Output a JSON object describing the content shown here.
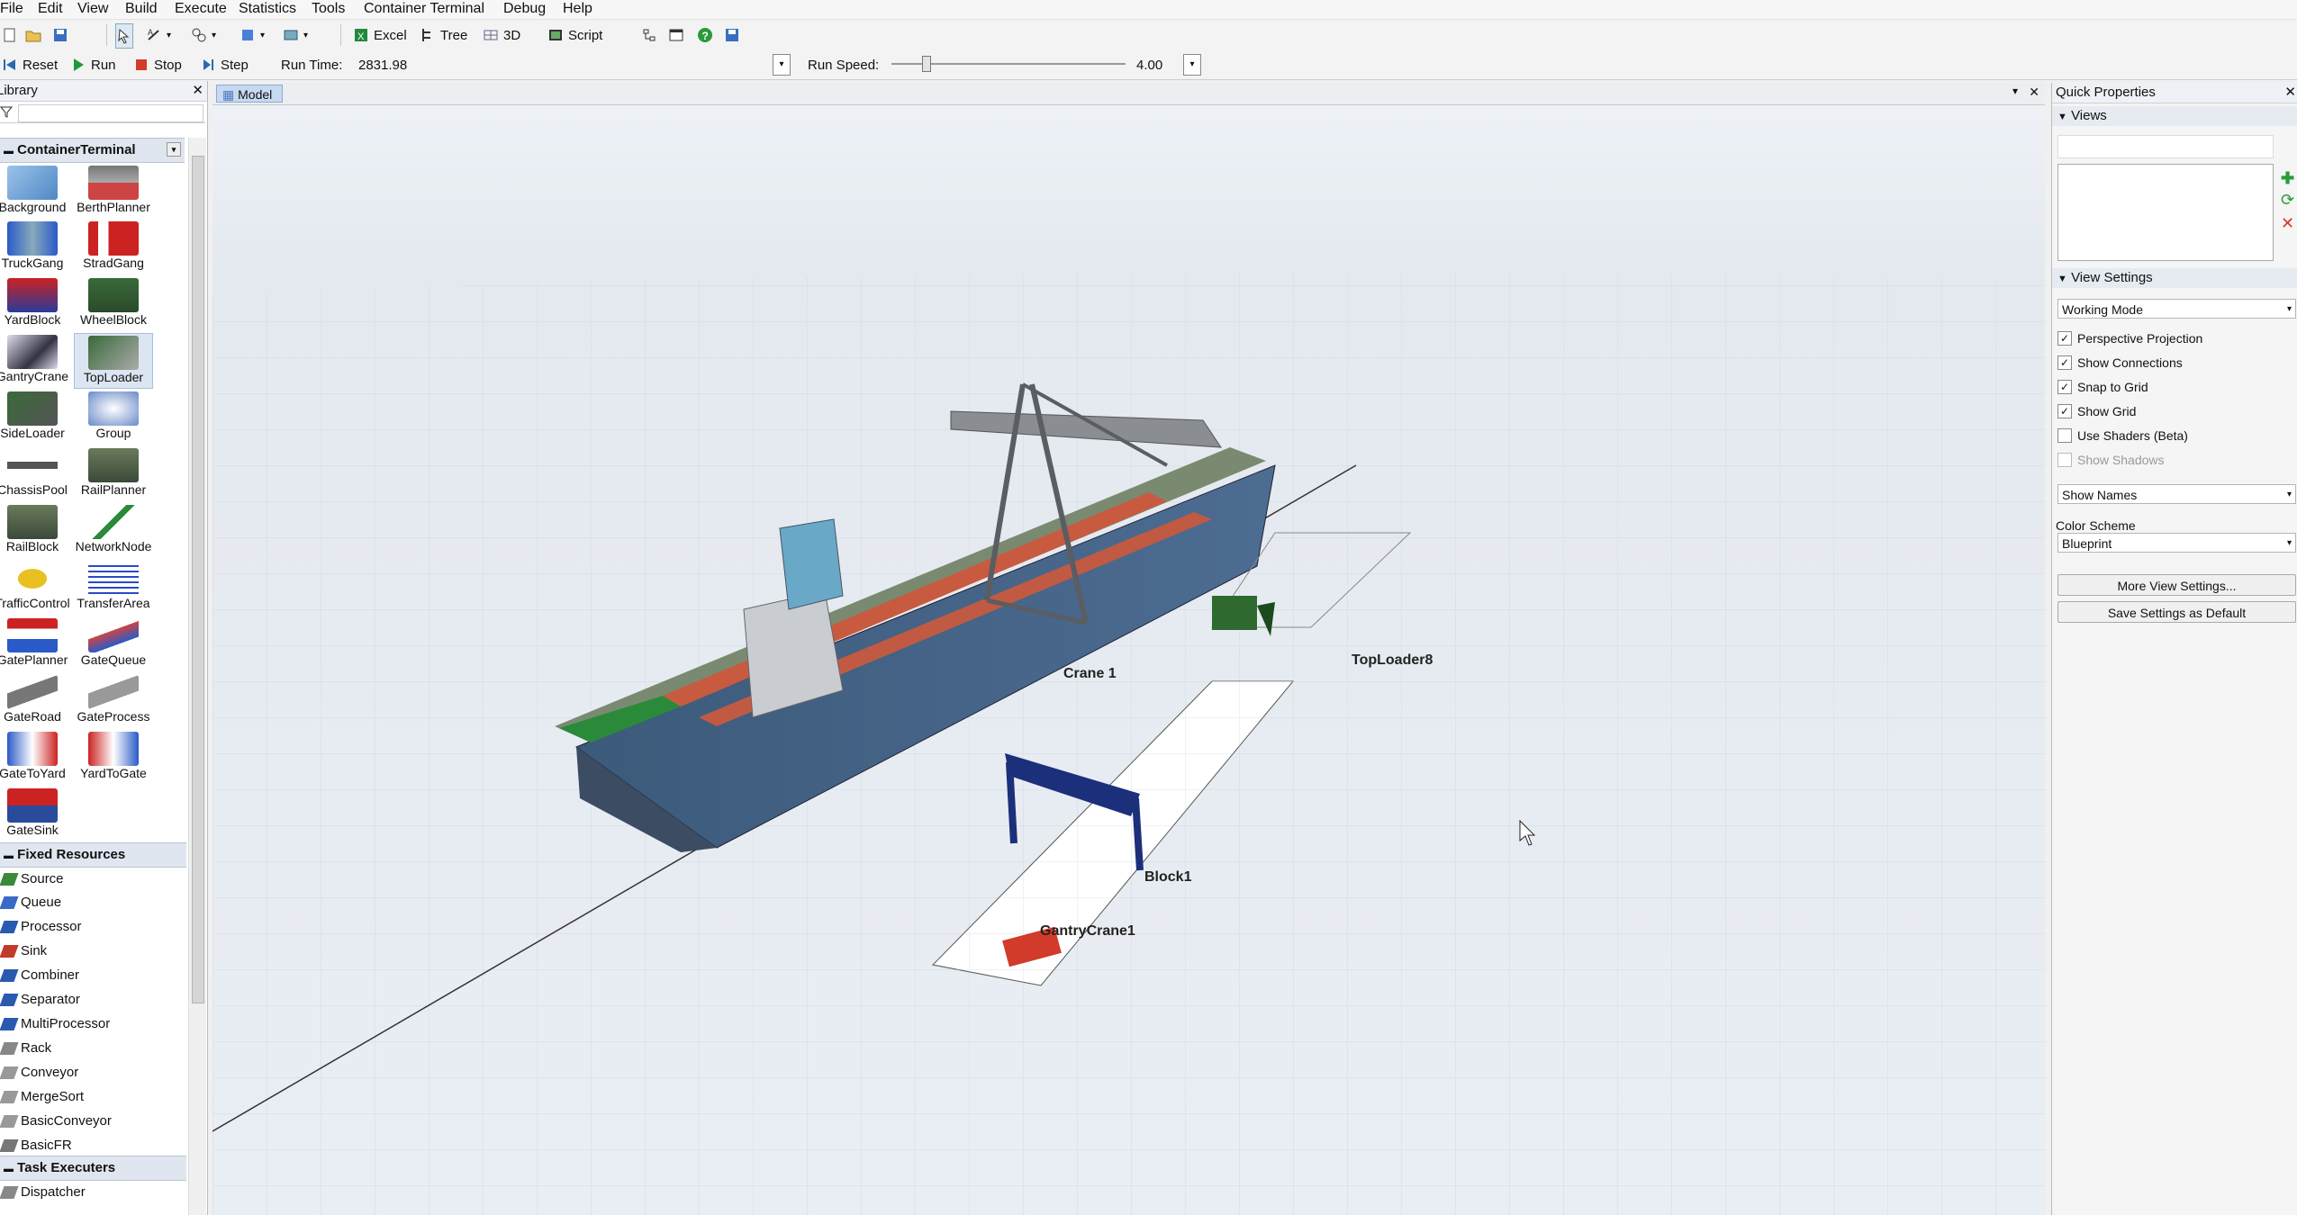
{
  "menu": [
    "File",
    "Edit",
    "View",
    "Build",
    "Execute",
    "Statistics",
    "Tools",
    "Container Terminal",
    "Debug",
    "Help"
  ],
  "toolbar1": {
    "excel": "Excel",
    "tree": "Tree",
    "three_d": "3D",
    "script": "Script"
  },
  "run": {
    "reset": "Reset",
    "run": "Run",
    "stop": "Stop",
    "step": "Step",
    "run_time_label": "Run Time:",
    "run_time_value": "2831.98",
    "run_speed_label": "Run Speed:",
    "run_speed_value": "4.00"
  },
  "library": {
    "title": "Library",
    "group": "ContainerTerminal",
    "items": [
      "Background",
      "BerthPlanner",
      "TruckGang",
      "StradGang",
      "YardBlock",
      "WheelBlock",
      "GantryCrane",
      "TopLoader",
      "SideLoader",
      "Group",
      "ChassisPool",
      "RailPlanner",
      "RailBlock",
      "NetworkNode",
      "TrafficControl",
      "TransferArea",
      "GatePlanner",
      "GateQueue",
      "GateRoad",
      "GateProcess",
      "GateToYard",
      "YardToGate",
      "GateSink"
    ],
    "fixed_title": "Fixed Resources",
    "fixed": [
      "Source",
      "Queue",
      "Processor",
      "Sink",
      "Combiner",
      "Separator",
      "MultiProcessor",
      "Rack",
      "Conveyor",
      "MergeSort",
      "BasicConveyor",
      "BasicFR"
    ],
    "task_title": "Task Executers",
    "task": [
      "Dispatcher"
    ]
  },
  "model": {
    "tab": "Model",
    "labels": {
      "crane": "Crane 1",
      "toploader": "TopLoader8",
      "block": "Block1",
      "gantry": "GantryCrane1"
    }
  },
  "quick": {
    "title": "Quick Properties",
    "views": "Views",
    "view_settings": "View Settings",
    "mode": "Working Mode",
    "checks": [
      {
        "label": "Perspective Projection",
        "checked": true
      },
      {
        "label": "Show Connections",
        "checked": true
      },
      {
        "label": "Snap to Grid",
        "checked": true
      },
      {
        "label": "Show Grid",
        "checked": true
      },
      {
        "label": "Use Shaders (Beta)",
        "checked": false
      },
      {
        "label": "Show Shadows",
        "checked": false
      }
    ],
    "names": "Show Names",
    "color_scheme_label": "Color Scheme",
    "color_scheme": "Blueprint",
    "more": "More View Settings...",
    "save": "Save Settings as Default"
  }
}
